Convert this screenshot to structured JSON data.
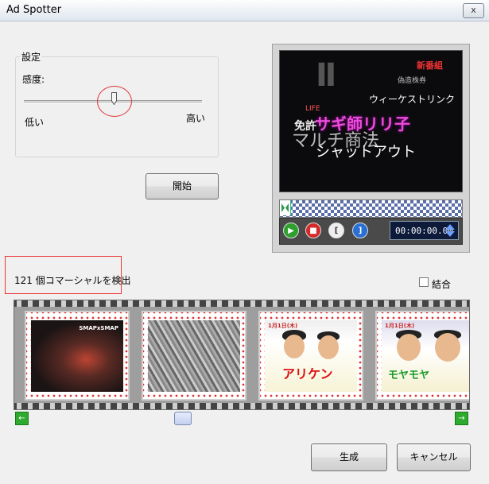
{
  "window": {
    "title": "Ad Spotter",
    "close_label": "x"
  },
  "settings": {
    "group_label": "設定",
    "sensitivity_label": "感度:",
    "low_label": "低い",
    "high_label": "高い",
    "slider_value_fraction": 0.5
  },
  "buttons": {
    "start": "開始",
    "generate": "生成",
    "cancel": "キャンセル"
  },
  "preview": {
    "video_text": {
      "big_kanji": "Ⅱ",
      "corner_red": "新番組",
      "corner_sub": "偽造株券",
      "line_a": "ウィーケストリンク",
      "line_b": "LIFE",
      "line_c": "免許",
      "line_d": "サギ師リリ子",
      "line_e": "マルチ商法",
      "line_f": "シャットアウト"
    },
    "controls": {
      "play_glyph": "▶",
      "stop_glyph": "■",
      "mark_in_glyph": "[",
      "mark_out_glyph": "]"
    },
    "timecode": "00:00:00.00"
  },
  "detection": {
    "result_text": "121 個コマーシャルを検出"
  },
  "merge": {
    "label": "結合",
    "checked": false
  },
  "filmstrip": {
    "captions": {
      "frame1": "SMAPxSMAP",
      "frame3_top": "1月1日(木)",
      "frame3_main": "アリケン",
      "frame4_top": "1月1日(木)",
      "frame4_main": "モヤモヤ"
    }
  },
  "scrollbar": {
    "left_glyph": "←",
    "right_glyph": "→",
    "position_fraction": 0.36
  },
  "colors": {
    "accent_green": "#2eaa2e",
    "highlight_red": "#dd3333",
    "timecode_bg": "#0d1a3a"
  }
}
